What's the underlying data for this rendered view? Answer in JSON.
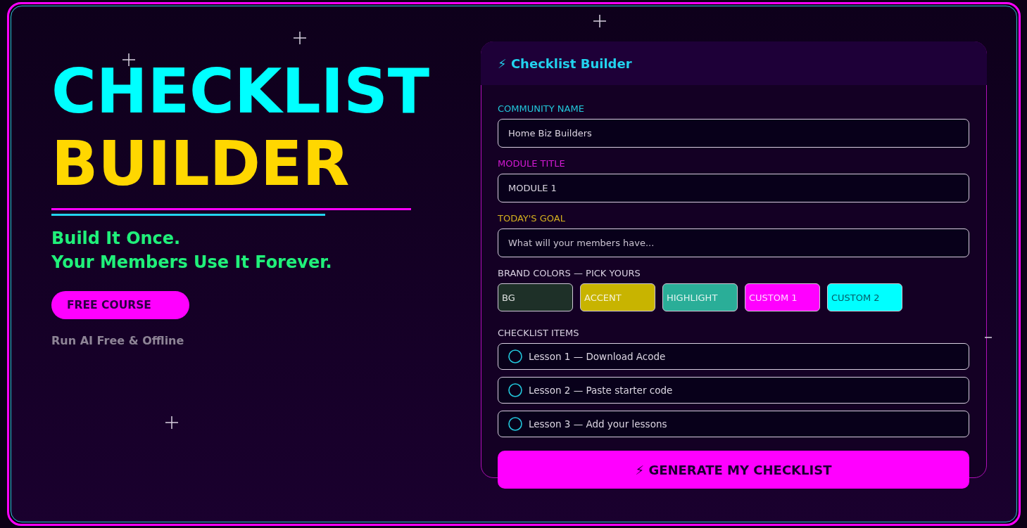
{
  "hero": {
    "title_lines": [
      {
        "text": "CHECKLIST",
        "color": "#00ffff"
      },
      {
        "text": "BUILDER",
        "color": "#ffd700"
      }
    ],
    "tagline": [
      "Build It Once.",
      "Your Members Use It Forever."
    ],
    "course_button": "FREE COURSE",
    "note": "Run AI Free & Offline"
  },
  "builder": {
    "title": "⚡ Checklist Builder",
    "fields": [
      {
        "label": "COMMUNITY NAME",
        "color": "#22c7dc",
        "value": "Home Biz Builders"
      },
      {
        "label": "MODULE TITLE",
        "color": "#d51ad5",
        "value": "MODULE 1"
      },
      {
        "label": "TODAY'S GOAL",
        "color": "#d4af1f",
        "placeholder": "What will your members have..."
      }
    ],
    "brand_colors": {
      "label": "BRAND COLORS — PICK YOURS",
      "swatches": [
        {
          "label": "BG",
          "color": "#1e3028"
        },
        {
          "label": "ACCENT",
          "color": "#c8b400"
        },
        {
          "label": "HIGHLIGHT",
          "color": "#2aae98"
        },
        {
          "label": "CUSTOM 1",
          "color": "#ff00ff"
        },
        {
          "label": "CUSTOM 2",
          "color": "#00ffff"
        }
      ]
    },
    "checklist": {
      "label": "CHECKLIST ITEMS",
      "items": [
        {
          "text": "Lesson 1 — Download Acode",
          "checked": false
        },
        {
          "text": "Lesson 2 — Paste starter code",
          "checked": false
        },
        {
          "text": "Lesson 3 — Add your lessons",
          "checked": false
        }
      ]
    },
    "generate_button": "⚡ GENERATE MY CHECKLIST"
  }
}
